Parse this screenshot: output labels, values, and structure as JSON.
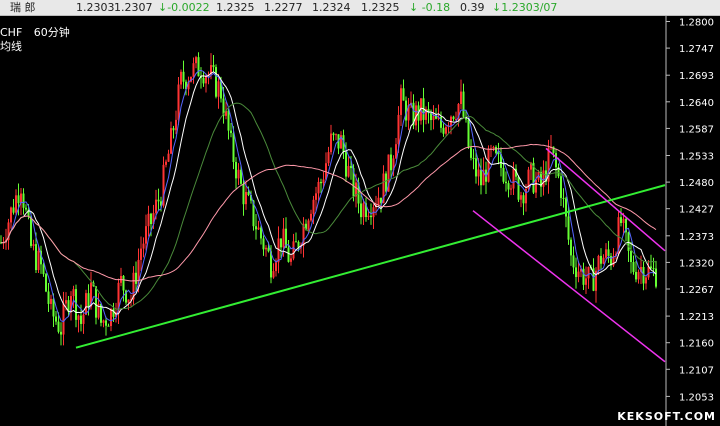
{
  "quote_bar": {
    "name": "瑞  郎",
    "open": "1.2303",
    "high": "1.2307",
    "change": "↓-0.0022",
    "v4": "1.2325",
    "v5": "1.2277",
    "v6": "1.2324",
    "v7": "1.2325",
    "change_pct": "↓ -0.18",
    "v9": "0.39",
    "last": "↓1.2303/07"
  },
  "symbol_label": "CHF",
  "period_label": "60分钟",
  "indicator_label": "均线",
  "watermark": "KEKSOFT.COM",
  "colors": {
    "background": "#000000",
    "up_candle": "#ff3333",
    "down_candle": "#66ff33",
    "trendline": "#33ee33",
    "channel": "#ee33ee",
    "ma_white": "#ffffff",
    "ma_blue": "#5566ff",
    "ma_green": "#4a8a3a",
    "ma_pink": "#ff99aa"
  },
  "chart_data": {
    "type": "candlestick",
    "ylim": [
      1.2,
      1.2805
    ],
    "y_ticks": [
      "1.2800",
      "1.2747",
      "1.2693",
      "1.2640",
      "1.2587",
      "1.2533",
      "1.2480",
      "1.2427",
      "1.2373",
      "1.2320",
      "1.2267",
      "1.2213",
      "1.2160",
      "1.2107",
      "1.2053"
    ],
    "close_path": [
      [
        0,
        1.236
      ],
      [
        10,
        1.242
      ],
      [
        20,
        1.248
      ],
      [
        30,
        1.235
      ],
      [
        40,
        1.231
      ],
      [
        50,
        1.222
      ],
      [
        60,
        1.219
      ],
      [
        70,
        1.227
      ],
      [
        80,
        1.22
      ],
      [
        90,
        1.227
      ],
      [
        100,
        1.22
      ],
      [
        110,
        1.222
      ],
      [
        120,
        1.228
      ],
      [
        130,
        1.225
      ],
      [
        140,
        1.235
      ],
      [
        150,
        1.24
      ],
      [
        160,
        1.246
      ],
      [
        170,
        1.256
      ],
      [
        180,
        1.268
      ],
      [
        190,
        1.27
      ],
      [
        200,
        1.271
      ],
      [
        210,
        1.269
      ],
      [
        220,
        1.266
      ],
      [
        230,
        1.255
      ],
      [
        240,
        1.247
      ],
      [
        250,
        1.242
      ],
      [
        260,
        1.237
      ],
      [
        270,
        1.232
      ],
      [
        280,
        1.237
      ],
      [
        290,
        1.232
      ],
      [
        300,
        1.238
      ],
      [
        310,
        1.244
      ],
      [
        320,
        1.248
      ],
      [
        330,
        1.256
      ],
      [
        340,
        1.256
      ],
      [
        350,
        1.248
      ],
      [
        360,
        1.243
      ],
      [
        370,
        1.244
      ],
      [
        380,
        1.246
      ],
      [
        390,
        1.252
      ],
      [
        400,
        1.264
      ],
      [
        410,
        1.261
      ],
      [
        420,
        1.262
      ],
      [
        430,
        1.26
      ],
      [
        440,
        1.259
      ],
      [
        450,
        1.262
      ],
      [
        460,
        1.264
      ],
      [
        470,
        1.252
      ],
      [
        480,
        1.248
      ],
      [
        490,
        1.253
      ],
      [
        500,
        1.251
      ],
      [
        510,
        1.249
      ],
      [
        520,
        1.246
      ],
      [
        530,
        1.249
      ],
      [
        540,
        1.247
      ],
      [
        550,
        1.254
      ],
      [
        560,
        1.247
      ],
      [
        570,
        1.233
      ],
      [
        580,
        1.23
      ],
      [
        590,
        1.228
      ],
      [
        600,
        1.233
      ],
      [
        610,
        1.233
      ],
      [
        620,
        1.24
      ],
      [
        630,
        1.231
      ],
      [
        640,
        1.231
      ],
      [
        650,
        1.23
      ],
      [
        655,
        1.23
      ]
    ],
    "trendline": {
      "x": [
        76,
        665
      ],
      "y": [
        1.215,
        1.2474
      ]
    },
    "channel_upper": {
      "x": [
        546,
        665
      ],
      "y": [
        1.2547,
        1.2343
      ]
    },
    "channel_lower": {
      "x": [
        473,
        665
      ],
      "y": [
        1.2423,
        1.2122
      ]
    }
  }
}
